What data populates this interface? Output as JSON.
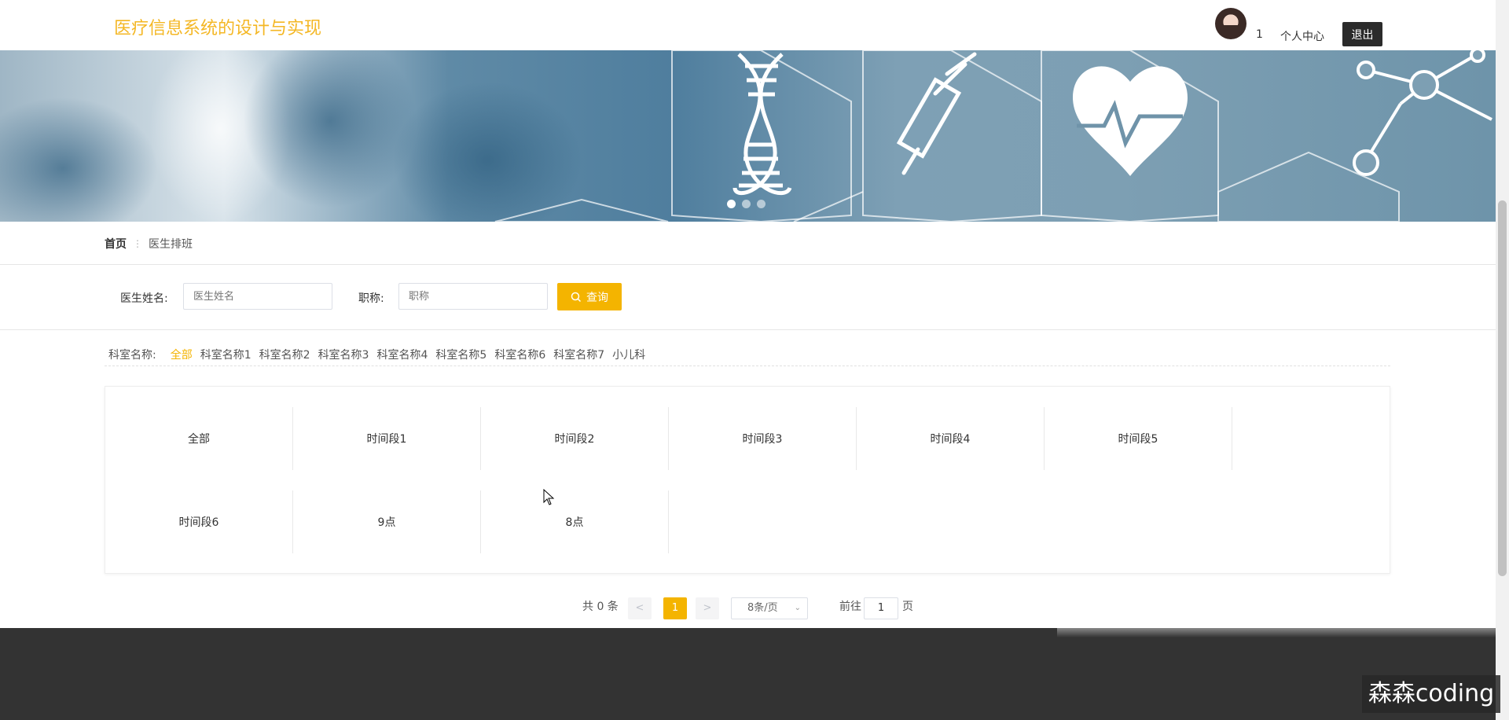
{
  "header": {
    "brand": "医疗信息系统的设计与实现",
    "user_count": "1",
    "profile_label": "个人中心",
    "logout_label": "退出",
    "brand_color": "#f4b724"
  },
  "banner": {
    "slides": 3,
    "active_slide": 1
  },
  "breadcrumb": {
    "home": "首页",
    "current": "医生排班"
  },
  "search": {
    "doctor_label": "医生姓名:",
    "doctor_placeholder": "医生姓名",
    "title_label": "职称:",
    "title_placeholder": "职称",
    "button_label": "查询",
    "accent": "#f4b400"
  },
  "departments": {
    "label": "科室名称:",
    "items": [
      "全部",
      "科室名称1",
      "科室名称2",
      "科室名称3",
      "科室名称4",
      "科室名称5",
      "科室名称6",
      "科室名称7",
      "小儿科"
    ],
    "active": "全部"
  },
  "time_slots": [
    "全部",
    "时间段1",
    "时间段2",
    "时间段3",
    "时间段4",
    "时间段5",
    "时间段6",
    "9点",
    "8点"
  ],
  "pagination": {
    "total_text": "共 0 条",
    "prev": "<",
    "current_page": "1",
    "next": ">",
    "page_size": "8条/页",
    "goto_label": "前往",
    "goto_value": "1",
    "page_suffix": "页"
  },
  "watermark": "森森coding"
}
